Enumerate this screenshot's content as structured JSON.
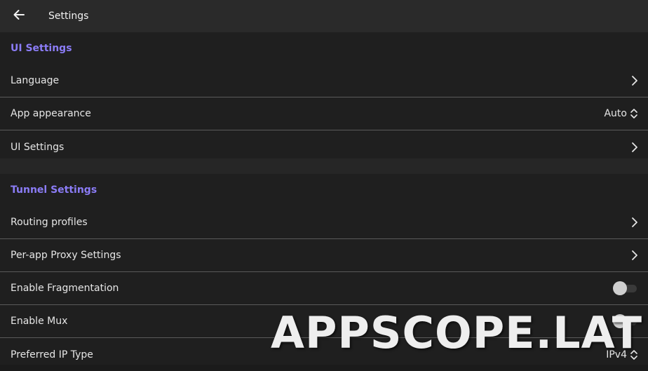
{
  "appbar": {
    "title": "Settings",
    "back_icon": "arrow-left-icon"
  },
  "colors": {
    "accent": "#8b7cf6",
    "appbar_bg": "#2a2a2a",
    "section_bg": "#1f1f1f",
    "divider": "#5a5a5a"
  },
  "ui_section": {
    "header": "UI Settings",
    "language": {
      "label": "Language"
    },
    "appearance": {
      "label": "App appearance",
      "value": "Auto"
    },
    "ui_settings": {
      "label": "UI Settings"
    }
  },
  "tunnel_section": {
    "header": "Tunnel Settings",
    "routing": {
      "label": "Routing profiles"
    },
    "per_app": {
      "label": "Per-app Proxy Settings"
    },
    "fragmentation": {
      "label": "Enable Fragmentation",
      "enabled": false
    },
    "mux": {
      "label": "Enable Mux",
      "enabled": false
    },
    "ip_type": {
      "label": "Preferred IP Type",
      "value": "IPv4"
    }
  },
  "watermark": {
    "text": "APPSCOPE.LAT"
  }
}
